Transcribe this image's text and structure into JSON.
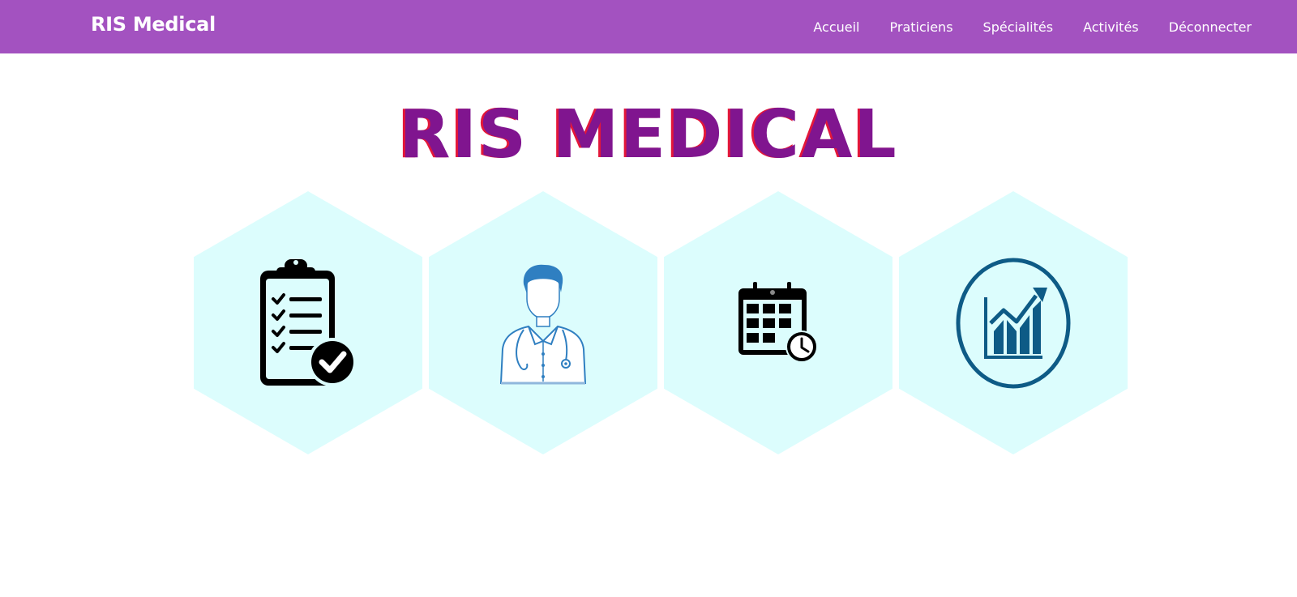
{
  "navbar": {
    "brand": "RIS Medical",
    "links": [
      "Accueil",
      "Praticiens",
      "Spécialités",
      "Activités",
      "Déconnecter"
    ]
  },
  "hero": {
    "title": "RIS MEDICAL"
  },
  "tiles": [
    {
      "icon": "clipboard-checklist-icon"
    },
    {
      "icon": "doctor-icon"
    },
    {
      "icon": "calendar-clock-icon"
    },
    {
      "icon": "growth-chart-icon"
    }
  ],
  "colors": {
    "navbar": "#a352c0",
    "title": "#80158f",
    "title_shadow": "#e3173a",
    "tile_background": "#dcfdfd",
    "chart_icon": "#0e5b86",
    "doctor_icon": "#2f7fc1"
  }
}
